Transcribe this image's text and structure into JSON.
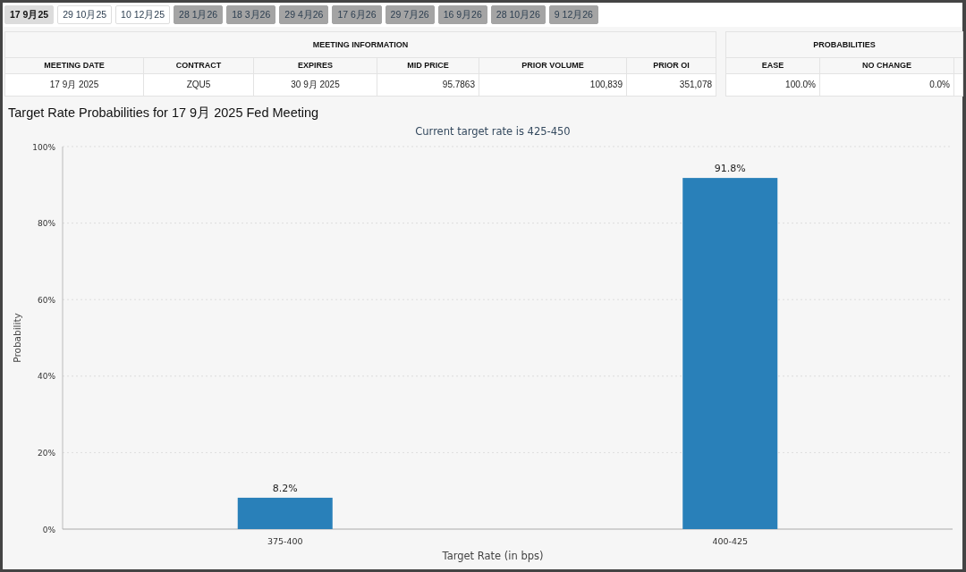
{
  "tabs": [
    {
      "label": "17 9月25",
      "selected": true,
      "disabled": false
    },
    {
      "label": "29 10月25",
      "selected": false,
      "disabled": false
    },
    {
      "label": "10 12月25",
      "selected": false,
      "disabled": false
    },
    {
      "label": "28 1月26",
      "selected": false,
      "disabled": true
    },
    {
      "label": "18 3月26",
      "selected": false,
      "disabled": true
    },
    {
      "label": "29 4月26",
      "selected": false,
      "disabled": true
    },
    {
      "label": "17 6月26",
      "selected": false,
      "disabled": true
    },
    {
      "label": "29 7月26",
      "selected": false,
      "disabled": true
    },
    {
      "label": "16 9月26",
      "selected": false,
      "disabled": true
    },
    {
      "label": "28 10月26",
      "selected": false,
      "disabled": true
    },
    {
      "label": "9 12月26",
      "selected": false,
      "disabled": true
    }
  ],
  "meeting_table": {
    "title": "MEETING INFORMATION",
    "columns": [
      "MEETING DATE",
      "CONTRACT",
      "EXPIRES",
      "MID PRICE",
      "PRIOR VOLUME",
      "PRIOR OI"
    ],
    "rows": [
      [
        "17 9月 2025",
        "ZQU5",
        "30 9月 2025",
        "95.7863",
        "100,839",
        "351,078"
      ]
    ]
  },
  "probabilities_table": {
    "title": "PROBABILITIES",
    "columns": [
      "EASE",
      "NO CHANGE"
    ],
    "rows": [
      [
        "100.0%",
        "0.0%"
      ]
    ]
  },
  "chart_heading": "Target Rate Probabilities for 17 9月 2025 Fed Meeting",
  "chart_data": {
    "type": "bar",
    "title": "Current target rate is 425-450",
    "xlabel": "Target Rate (in bps)",
    "ylabel": "Probability",
    "categories": [
      "375-400",
      "400-425"
    ],
    "values": [
      8.2,
      91.8
    ],
    "color": "#2980b9",
    "ylim": [
      0,
      100
    ],
    "grid": true,
    "yticks": [
      {
        "value": 0,
        "label": "0%"
      },
      {
        "value": 20,
        "label": "20%"
      },
      {
        "value": 40,
        "label": "40%"
      },
      {
        "value": 60,
        "label": "60%"
      },
      {
        "value": 80,
        "label": "80%"
      },
      {
        "value": 100,
        "label": "100%"
      }
    ],
    "value_labels": [
      "8.2%",
      "91.8%"
    ]
  }
}
